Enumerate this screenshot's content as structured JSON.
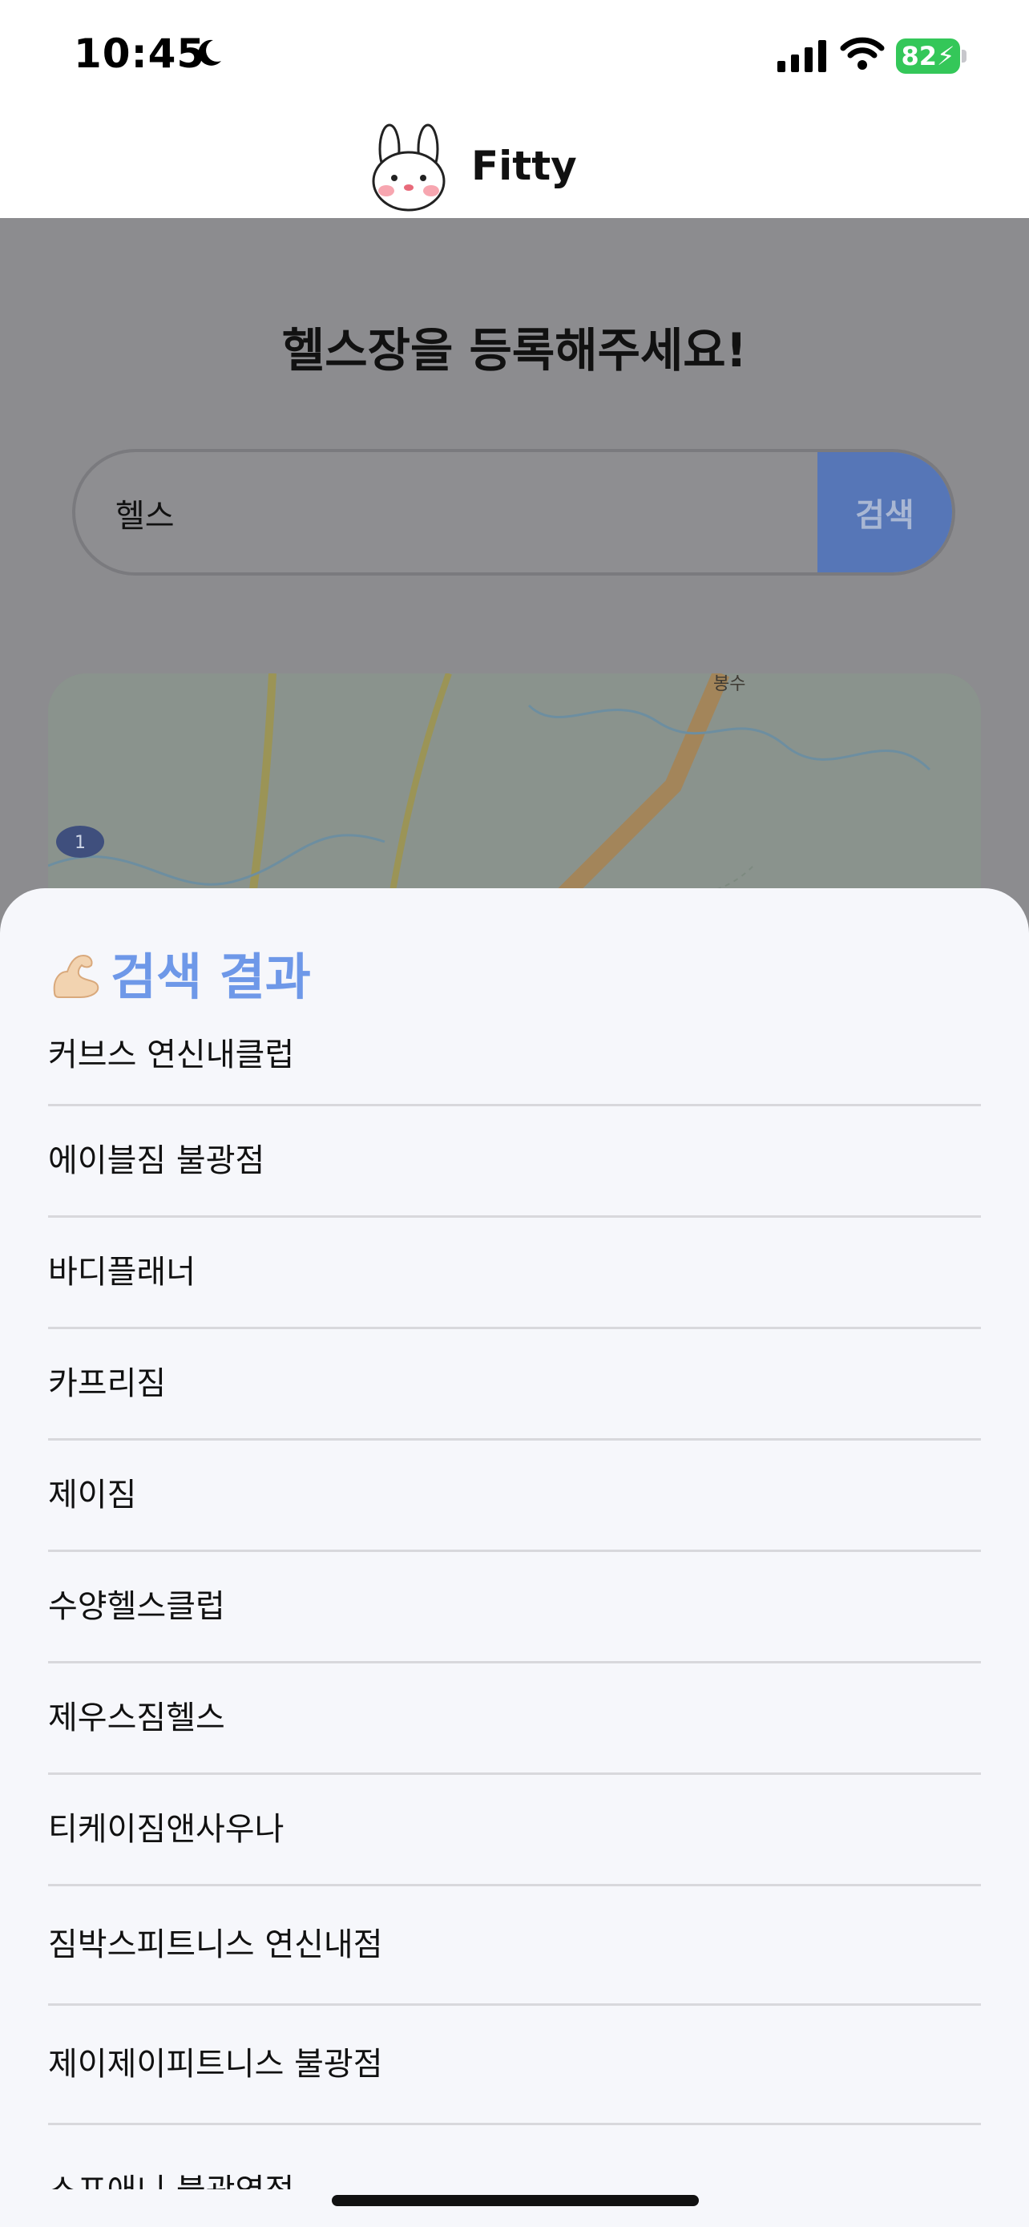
{
  "status_bar": {
    "time": "10:45",
    "battery": "82",
    "icons": [
      "moon-icon",
      "signal-icon",
      "wifi-icon",
      "battery-icon"
    ]
  },
  "header": {
    "title": "Fitty",
    "logo_icon": "bunny-logo-icon"
  },
  "page": {
    "heading": "헬스장을 등록해주세요!",
    "search": {
      "value": "헬스",
      "button_label": "검색"
    }
  },
  "results": {
    "title": "검색 결과",
    "title_icon": "flexed-biceps-icon",
    "items": [
      "커브스 연신내클럽",
      "에이블짐 불광점",
      "바디플래너",
      "카프리짐",
      "제이짐",
      "수양헬스클럽",
      "제우스짐헬스",
      "티케이짐앤사우나",
      "짐박스피트니스 연신내점",
      "제이제이피트니스 불광점",
      "스포애니 불광역점"
    ]
  },
  "map": {
    "labels": [
      "1",
      "봉수"
    ]
  },
  "colors": {
    "accent": "#6e98e8",
    "search_button": "#5676b7",
    "battery": "#34c759"
  }
}
